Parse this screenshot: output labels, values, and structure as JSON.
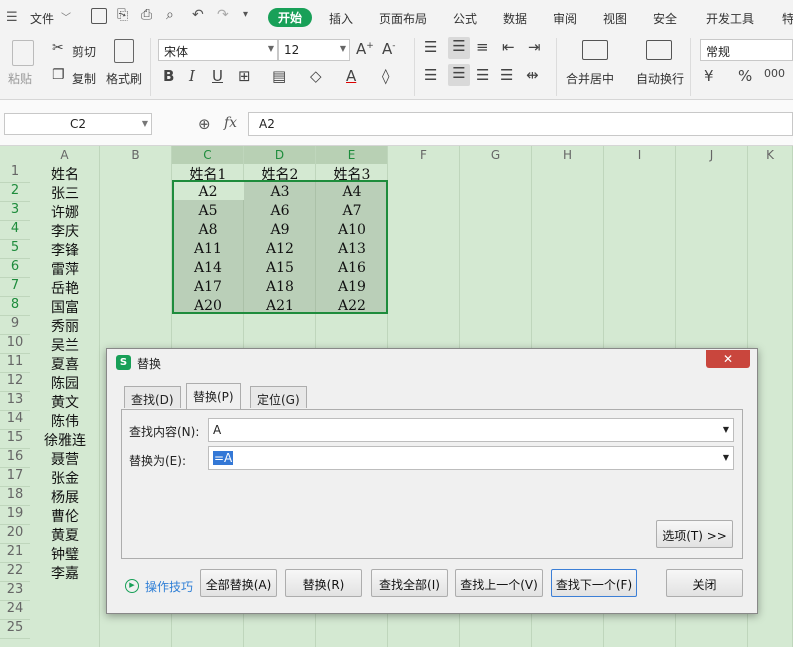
{
  "menubar": {
    "file": "文件",
    "tabs": [
      "开始",
      "插入",
      "页面布局",
      "公式",
      "数据",
      "审阅",
      "视图",
      "安全",
      "开发工具",
      "特"
    ],
    "active_tab": "开始",
    "accent": "#18a058"
  },
  "ribbon": {
    "paste": "粘贴",
    "cut": "剪切",
    "copy": "复制",
    "format_painter": "格式刷",
    "font_name": "宋体",
    "font_size": "12",
    "merge_center": "合并居中",
    "wrap_text": "自动换行",
    "number_format": "常规"
  },
  "formula_bar": {
    "name_box": "C2",
    "fx": "fx",
    "formula": "A2"
  },
  "sheet": {
    "columns": [
      "A",
      "B",
      "C",
      "D",
      "E",
      "F",
      "G",
      "H",
      "I",
      "J",
      "K"
    ],
    "rows": [
      "1",
      "2",
      "3",
      "4",
      "5",
      "6",
      "7",
      "8",
      "9",
      "10",
      "11",
      "12",
      "13",
      "14",
      "15",
      "16",
      "17",
      "18",
      "19",
      "20",
      "21",
      "22",
      "23",
      "24",
      "25"
    ],
    "col_a": [
      "姓名",
      "张三",
      "许娜",
      "李庆",
      "李锋",
      "雷萍",
      "岳艳",
      "国富",
      "秀丽",
      "吴兰",
      "夏喜",
      "陈园",
      "黄文",
      "陈伟",
      "徐雅连",
      "聂营",
      "张金",
      "杨展",
      "曹伦",
      "黄夏",
      "钟璧",
      "李嘉"
    ],
    "headers_cde": [
      "姓名1",
      "姓名2",
      "姓名3"
    ],
    "grid_cde": [
      [
        "A2",
        "A3",
        "A4"
      ],
      [
        "A5",
        "A6",
        "A7"
      ],
      [
        "A8",
        "A9",
        "A10"
      ],
      [
        "A11",
        "A12",
        "A13"
      ],
      [
        "A14",
        "A15",
        "A16"
      ],
      [
        "A17",
        "A18",
        "A19"
      ],
      [
        "A20",
        "A21",
        "A22"
      ]
    ]
  },
  "dialog": {
    "title": "替换",
    "tabs": [
      "查找(D)",
      "替换(P)",
      "定位(G)"
    ],
    "find_label": "查找内容(N):",
    "find_value": "A",
    "replace_label": "替换为(E):",
    "replace_value": "=A",
    "options_button": "选项(T) >>",
    "tips": "操作技巧",
    "replace_all": "全部替换(A)",
    "replace": "替换(R)",
    "find_all": "查找全部(I)",
    "find_prev": "查找上一个(V)",
    "find_next": "查找下一个(F)",
    "close": "关闭"
  }
}
